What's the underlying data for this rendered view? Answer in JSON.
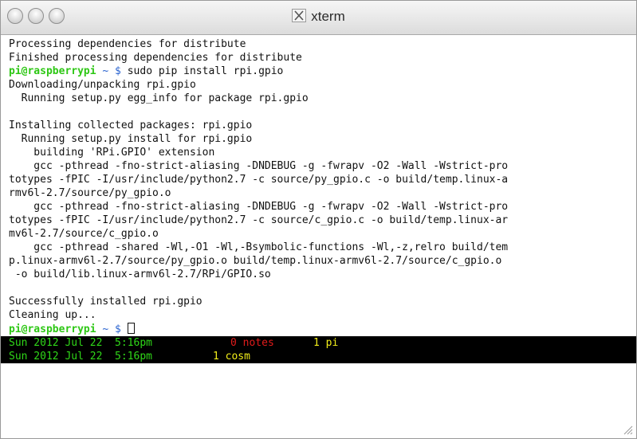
{
  "window": {
    "title": "xterm"
  },
  "terminal": {
    "lines": [
      "Processing dependencies for distribute",
      "Finished processing dependencies for distribute",
      "",
      "Downloading/unpacking rpi.gpio",
      "  Running setup.py egg_info for package rpi.gpio",
      "",
      "Installing collected packages: rpi.gpio",
      "  Running setup.py install for rpi.gpio",
      "    building 'RPi.GPIO' extension",
      "    gcc -pthread -fno-strict-aliasing -DNDEBUG -g -fwrapv -O2 -Wall -Wstrict-pro",
      "totypes -fPIC -I/usr/include/python2.7 -c source/py_gpio.c -o build/temp.linux-a",
      "rmv6l-2.7/source/py_gpio.o",
      "    gcc -pthread -fno-strict-aliasing -DNDEBUG -g -fwrapv -O2 -Wall -Wstrict-pro",
      "totypes -fPIC -I/usr/include/python2.7 -c source/c_gpio.c -o build/temp.linux-ar",
      "mv6l-2.7/source/c_gpio.o",
      "    gcc -pthread -shared -Wl,-O1 -Wl,-Bsymbolic-functions -Wl,-z,relro build/tem",
      "p.linux-armv6l-2.7/source/py_gpio.o build/temp.linux-armv6l-2.7/source/c_gpio.o",
      " -o build/lib.linux-armv6l-2.7/RPi/GPIO.so",
      "",
      "Successfully installed rpi.gpio",
      "Cleaning up..."
    ],
    "prompt1": {
      "host": "pi@raspberrypi",
      "dir": " ~",
      "symbol": " $",
      "command": " sudo pip install rpi.gpio"
    },
    "prompt2": {
      "host": "pi@raspberrypi",
      "dir": " ~",
      "symbol": " $",
      "command": " "
    }
  },
  "statusbar": {
    "row1": {
      "datetime": "Sun 2012 Jul 22  5:16pm",
      "notes": "0 notes",
      "count": "1 pi"
    },
    "row2": {
      "datetime": "Sun 2012 Jul 22  5:16pm",
      "count": "1 cosm"
    }
  },
  "colors": {
    "prompt_host": "#2dc714",
    "prompt_path": "#2b64d0",
    "status_bg": "#000000",
    "status_datetime": "#2fd818",
    "status_notes": "#e11b1b",
    "status_count": "#f2ee1a"
  },
  "icons": {
    "window_controls": [
      "close-button",
      "minimize-button",
      "zoom-button"
    ],
    "app_icon": "x11-icon",
    "resize": "resize-grip-icon"
  }
}
